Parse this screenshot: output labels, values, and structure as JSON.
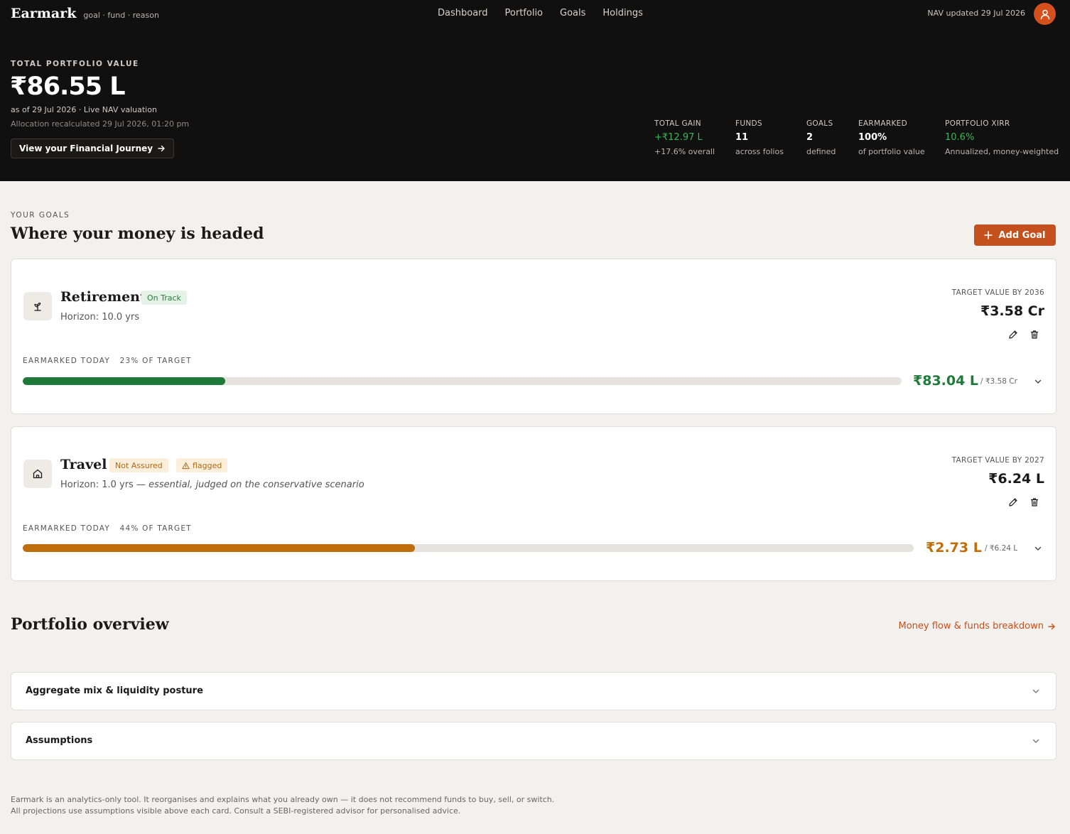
{
  "brand": {
    "name": "Earmark",
    "tagline": "goal · fund · reason"
  },
  "nav": {
    "items": [
      "Dashboard",
      "Portfolio",
      "Goals",
      "Holdings"
    ],
    "status": "NAV updated 29 Jul 2026"
  },
  "colors": {
    "accent": "#c4501d",
    "hero_bg": "#111010",
    "on_track": "#1f7a3a",
    "not_assured": "#c06d0b"
  },
  "hero": {
    "label": "TOTAL PORTFOLIO VALUE",
    "value": "₹86.55 L",
    "as_of": "as of 29 Jul 2026 · Live NAV valuation",
    "recalc": "Allocation recalculated 29 Jul 2026, 01:20 pm",
    "journey_button": "View your Financial Journey",
    "stats": [
      {
        "label": "TOTAL GAIN",
        "value": "+₹12.97 L",
        "sub": "+17.6% overall"
      },
      {
        "label": "FUNDS",
        "value": "11",
        "sub": "across folios"
      },
      {
        "label": "GOALS",
        "value": "2",
        "sub": "defined"
      },
      {
        "label": "EARMARKED",
        "value": "100%",
        "sub": "of portfolio value"
      },
      {
        "label": "PORTFOLIO XIRR",
        "value": "10.6%",
        "sub": "Annualized, money-weighted"
      }
    ]
  },
  "goals_section": {
    "kicker": "YOUR GOALS",
    "title": "Where your money is headed",
    "add_button": "Add Goal",
    "goals": [
      {
        "name": "Retirement",
        "icon": "sprout-icon",
        "badge": "On Track",
        "horizon": "Horizon: 10.0 yrs",
        "target_label": "TARGET VALUE BY 2036",
        "target_value": "₹3.58 Cr",
        "earmarked_label": "EARMARKED TODAY",
        "pct_label": "23% OF TARGET",
        "progress": 0.23,
        "current_value": "₹83.04 L",
        "of_target": "/ ₹3.58 Cr"
      },
      {
        "name": "Travel",
        "icon": "home-icon",
        "badge": "Not Assured",
        "flag": "flagged",
        "horizon": "Horizon: 1.0 yrs — ",
        "horizon_note": "essential, judged on the conservative scenario",
        "target_label": "TARGET VALUE BY 2027",
        "target_value": "₹6.24 L",
        "earmarked_label": "EARMARKED TODAY",
        "pct_label": "44% OF TARGET",
        "progress": 0.44,
        "current_value": "₹2.73 L",
        "of_target": "/ ₹6.24 L"
      }
    ]
  },
  "overview": {
    "title": "Portfolio overview",
    "link": "Money flow & funds breakdown",
    "sections": [
      "Aggregate mix & liquidity posture",
      "Assumptions"
    ]
  },
  "disclaimer": "Earmark is an analytics-only tool. It reorganises and explains what you already own — it does not recommend funds to buy, sell, or switch. All projections use assumptions visible above each card. Consult a SEBI-registered advisor for personalised advice."
}
